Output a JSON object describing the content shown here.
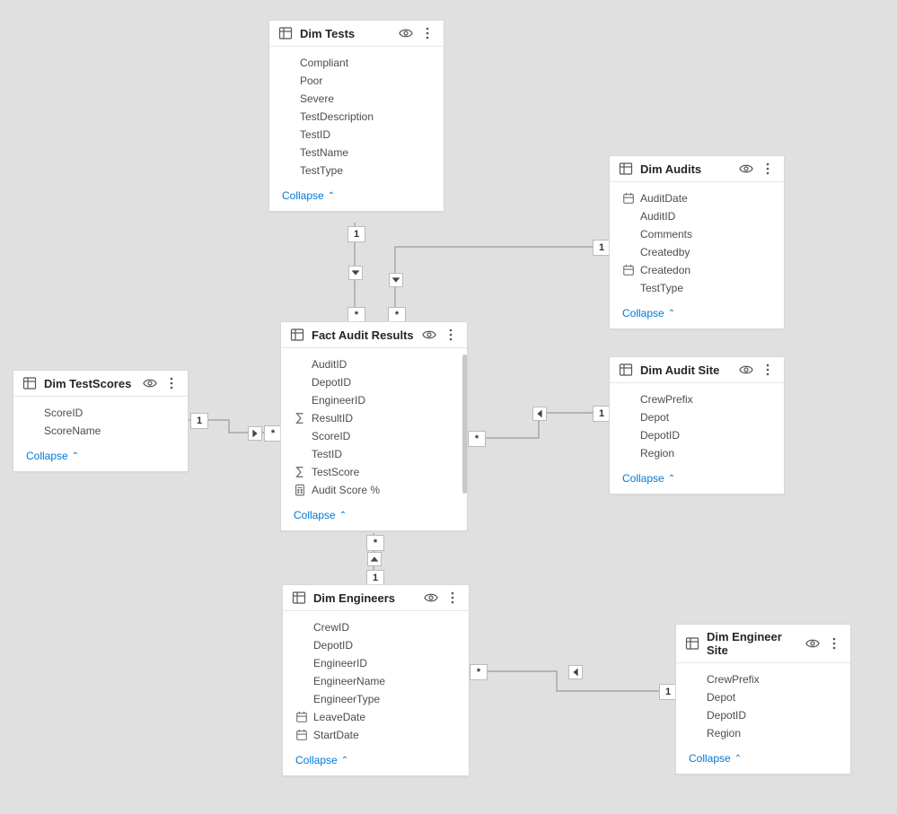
{
  "collapse_label": "Collapse",
  "symbols": {
    "one": "1",
    "many": "*"
  },
  "tables": {
    "dimTests": {
      "title": "Dim Tests",
      "fields": [
        {
          "name": "Compliant",
          "icon": "none"
        },
        {
          "name": "Poor",
          "icon": "none"
        },
        {
          "name": "Severe",
          "icon": "none"
        },
        {
          "name": "TestDescription",
          "icon": "none"
        },
        {
          "name": "TestID",
          "icon": "none"
        },
        {
          "name": "TestName",
          "icon": "none"
        },
        {
          "name": "TestType",
          "icon": "none"
        }
      ]
    },
    "dimAudits": {
      "title": "Dim Audits",
      "fields": [
        {
          "name": "AuditDate",
          "icon": "date"
        },
        {
          "name": "AuditID",
          "icon": "none"
        },
        {
          "name": "Comments",
          "icon": "none"
        },
        {
          "name": "Createdby",
          "icon": "none"
        },
        {
          "name": "Createdon",
          "icon": "date"
        },
        {
          "name": "TestType",
          "icon": "none"
        }
      ]
    },
    "dimTestScores": {
      "title": "Dim TestScores",
      "fields": [
        {
          "name": "ScoreID",
          "icon": "none"
        },
        {
          "name": "ScoreName",
          "icon": "none"
        }
      ]
    },
    "factAuditResults": {
      "title": "Fact Audit Results",
      "fields": [
        {
          "name": "AuditID",
          "icon": "none"
        },
        {
          "name": "DepotID",
          "icon": "none"
        },
        {
          "name": "EngineerID",
          "icon": "none"
        },
        {
          "name": "ResultID",
          "icon": "sigma"
        },
        {
          "name": "ScoreID",
          "icon": "none"
        },
        {
          "name": "TestID",
          "icon": "none"
        },
        {
          "name": "TestScore",
          "icon": "sigma"
        },
        {
          "name": "Audit Score %",
          "icon": "calc"
        }
      ]
    },
    "dimAuditSite": {
      "title": "Dim Audit Site",
      "fields": [
        {
          "name": "CrewPrefix",
          "icon": "none"
        },
        {
          "name": "Depot",
          "icon": "none"
        },
        {
          "name": "DepotID",
          "icon": "none"
        },
        {
          "name": "Region",
          "icon": "none"
        }
      ]
    },
    "dimEngineers": {
      "title": "Dim Engineers",
      "fields": [
        {
          "name": "CrewID",
          "icon": "none"
        },
        {
          "name": "DepotID",
          "icon": "none"
        },
        {
          "name": "EngineerID",
          "icon": "none"
        },
        {
          "name": "EngineerName",
          "icon": "none"
        },
        {
          "name": "EngineerType",
          "icon": "none"
        },
        {
          "name": "LeaveDate",
          "icon": "date"
        },
        {
          "name": "StartDate",
          "icon": "date"
        }
      ]
    },
    "dimEngineerSite": {
      "title": "Dim Engineer Site",
      "fields": [
        {
          "name": "CrewPrefix",
          "icon": "none"
        },
        {
          "name": "Depot",
          "icon": "none"
        },
        {
          "name": "DepotID",
          "icon": "none"
        },
        {
          "name": "Region",
          "icon": "none"
        }
      ]
    }
  },
  "relationships": [
    {
      "from": "dimTests",
      "to": "factAuditResults",
      "from_card": "1",
      "to_card": "*",
      "direction": "to"
    },
    {
      "from": "dimAudits",
      "to": "factAuditResults",
      "from_card": "1",
      "to_card": "*",
      "direction": "to"
    },
    {
      "from": "dimTestScores",
      "to": "factAuditResults",
      "from_card": "1",
      "to_card": "*",
      "direction": "to"
    },
    {
      "from": "dimAuditSite",
      "to": "factAuditResults",
      "from_card": "1",
      "to_card": "*",
      "direction": "to"
    },
    {
      "from": "dimEngineers",
      "to": "factAuditResults",
      "from_card": "1",
      "to_card": "*",
      "direction": "to"
    },
    {
      "from": "dimEngineerSite",
      "to": "dimEngineers",
      "from_card": "1",
      "to_card": "*",
      "direction": "to"
    }
  ]
}
